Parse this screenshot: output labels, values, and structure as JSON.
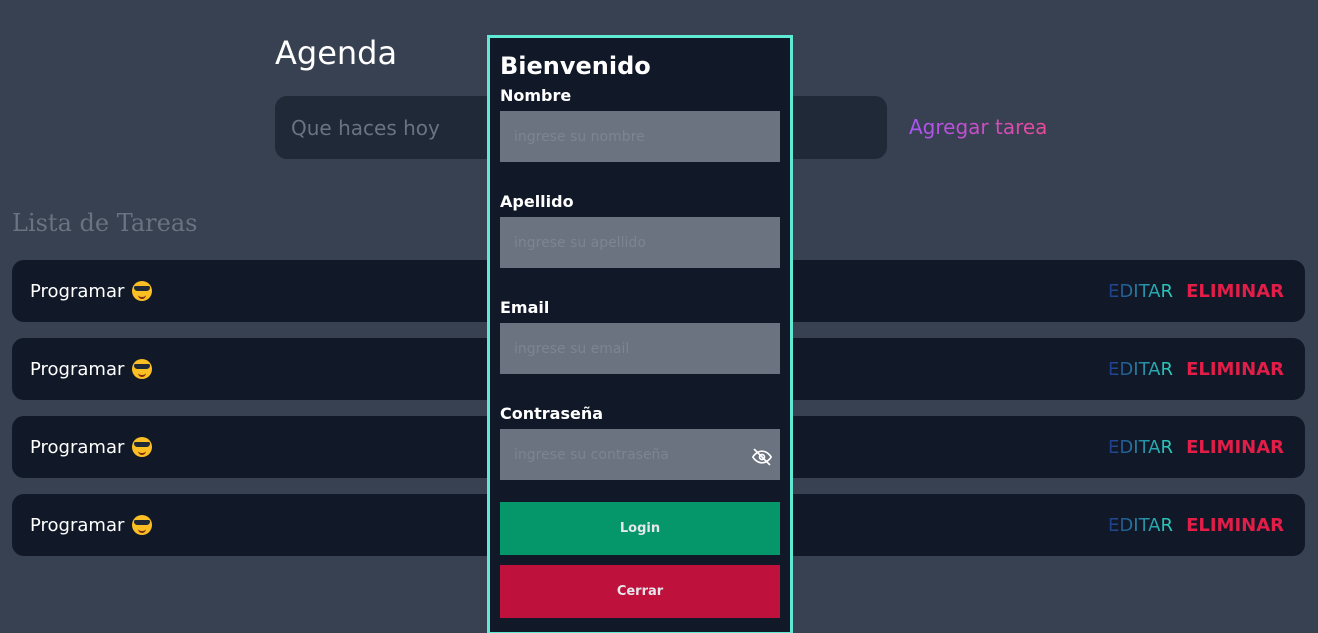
{
  "header": {
    "title": "Agenda"
  },
  "task_form": {
    "placeholder": "Que haces hoy",
    "add_label": "Agregar tarea"
  },
  "list": {
    "title": "Lista de Tareas",
    "items": [
      {
        "name": "Programar",
        "edit_label": "EDITAR",
        "delete_label": "ELIMINAR"
      },
      {
        "name": "Programar",
        "edit_label": "EDITAR",
        "delete_label": "ELIMINAR"
      },
      {
        "name": "Programar",
        "edit_label": "EDITAR",
        "delete_label": "ELIMINAR"
      },
      {
        "name": "Programar",
        "edit_label": "EDITAR",
        "delete_label": "ELIMINAR"
      }
    ],
    "emoji": "smiling-face-with-sunglasses-icon"
  },
  "modal": {
    "title": "Bienvenido",
    "fields": {
      "nombre": {
        "label": "Nombre",
        "placeholder": "ingrese su nombre"
      },
      "apellido": {
        "label": "Apellido",
        "placeholder": "ingrese su apellido"
      },
      "email": {
        "label": "Email",
        "placeholder": "ingrese su email"
      },
      "password": {
        "label": "Contraseña",
        "placeholder": "ingrese su contraseña"
      }
    },
    "login_label": "Login",
    "close_label": "Cerrar"
  },
  "colors": {
    "background": "#374151",
    "card": "#111827",
    "modal_border": "#5eead4",
    "login": "#059669",
    "close": "#be123c",
    "delete": "#e11d48"
  }
}
